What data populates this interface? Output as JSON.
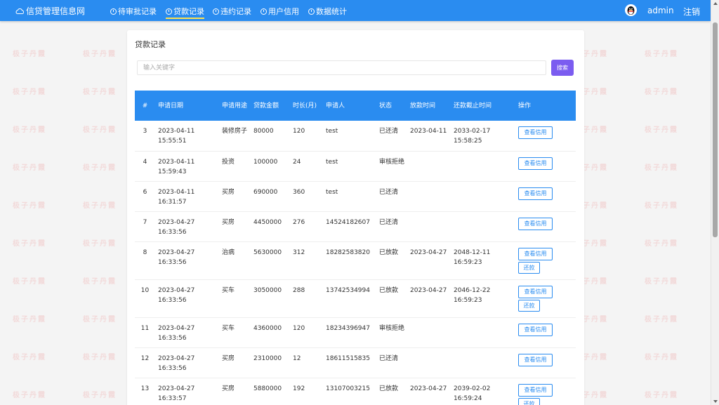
{
  "nav": {
    "brand": "信贷管理信息网",
    "items": [
      {
        "label": "待审批记录"
      },
      {
        "label": "贷款记录"
      },
      {
        "label": "违约记录"
      },
      {
        "label": "用户信用"
      },
      {
        "label": "数据统计"
      }
    ],
    "active_index": 1,
    "user": "admin",
    "logout": "注销"
  },
  "watermark": "极子丹霞",
  "card": {
    "title": "贷款记录",
    "search_placeholder": "输入关键字",
    "search_button": "搜索"
  },
  "table": {
    "headers": [
      "#",
      "申请日期",
      "申请用途",
      "贷款金额",
      "时长(月)",
      "申请人",
      "状态",
      "放款时间",
      "还款截止时间",
      "操作"
    ],
    "rows": [
      {
        "id": "3",
        "date": "2023-04-11 15:55:51",
        "purpose": "装修房子",
        "amount": "80000",
        "term": "120",
        "applicant": "test",
        "status": "已还清",
        "release": "2023-04-11",
        "deadline": "2033-02-17 15:58:25",
        "repay": false
      },
      {
        "id": "4",
        "date": "2023-04-11 15:59:43",
        "purpose": "投资",
        "amount": "100000",
        "term": "24",
        "applicant": "test",
        "status": "审核拒绝",
        "release": "",
        "deadline": "",
        "repay": false
      },
      {
        "id": "6",
        "date": "2023-04-11 16:31:57",
        "purpose": "买房",
        "amount": "690000",
        "term": "360",
        "applicant": "test",
        "status": "已还清",
        "release": "",
        "deadline": "",
        "repay": false
      },
      {
        "id": "7",
        "date": "2023-04-27 16:33:56",
        "purpose": "买房",
        "amount": "4450000",
        "term": "276",
        "applicant": "14524182607",
        "status": "已还清",
        "release": "",
        "deadline": "",
        "repay": false
      },
      {
        "id": "8",
        "date": "2023-04-27 16:33:56",
        "purpose": "治病",
        "amount": "5630000",
        "term": "312",
        "applicant": "18282583820",
        "status": "已放款",
        "release": "2023-04-27",
        "deadline": "2048-12-11 16:59:23",
        "repay": true
      },
      {
        "id": "10",
        "date": "2023-04-27 16:33:56",
        "purpose": "买车",
        "amount": "3050000",
        "term": "288",
        "applicant": "13742534994",
        "status": "已放款",
        "release": "2023-04-27",
        "deadline": "2046-12-22 16:59:23",
        "repay": true
      },
      {
        "id": "11",
        "date": "2023-04-27 16:33:56",
        "purpose": "买车",
        "amount": "4360000",
        "term": "120",
        "applicant": "18234396947",
        "status": "审核拒绝",
        "release": "",
        "deadline": "",
        "repay": false
      },
      {
        "id": "12",
        "date": "2023-04-27 16:33:56",
        "purpose": "买房",
        "amount": "2310000",
        "term": "12",
        "applicant": "18611515835",
        "status": "已还清",
        "release": "",
        "deadline": "",
        "repay": false
      },
      {
        "id": "13",
        "date": "2023-04-27 16:33:57",
        "purpose": "买房",
        "amount": "5880000",
        "term": "192",
        "applicant": "13107003215",
        "status": "已放款",
        "release": "2023-04-27",
        "deadline": "2039-02-02 16:59:24",
        "repay": true
      }
    ],
    "credit_button": "查看信用",
    "repay_button": "还款"
  },
  "colors": {
    "primary": "#2a8cf0",
    "search_button": "#7b5cf0",
    "active_underline": "#ffe14d"
  }
}
